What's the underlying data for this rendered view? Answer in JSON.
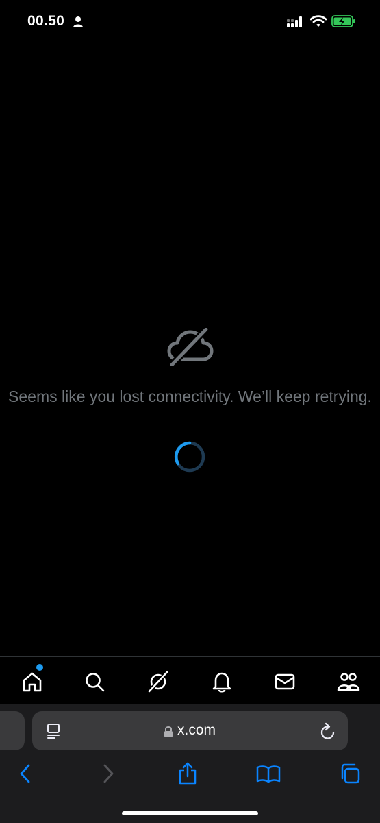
{
  "status_bar": {
    "time": "00.50"
  },
  "offline": {
    "message": "Seems like you lost connectivity. We’ll keep retrying."
  },
  "tab_bar": {
    "items": [
      {
        "icon": "home-icon",
        "has_badge": true
      },
      {
        "icon": "search-icon"
      },
      {
        "icon": "grok-icon"
      },
      {
        "icon": "bell-icon"
      },
      {
        "icon": "mail-icon"
      },
      {
        "icon": "communities-icon"
      }
    ]
  },
  "browser": {
    "url": "x.com",
    "icons": [
      "reader-icon",
      "lock-icon",
      "reload-icon",
      "back-icon",
      "forward-icon",
      "share-icon",
      "bookmarks-icon",
      "tabs-icon"
    ]
  },
  "colors": {
    "accent": "#1d9bf0",
    "muted_text": "#71767b",
    "browser_blue": "#0a84ff"
  }
}
